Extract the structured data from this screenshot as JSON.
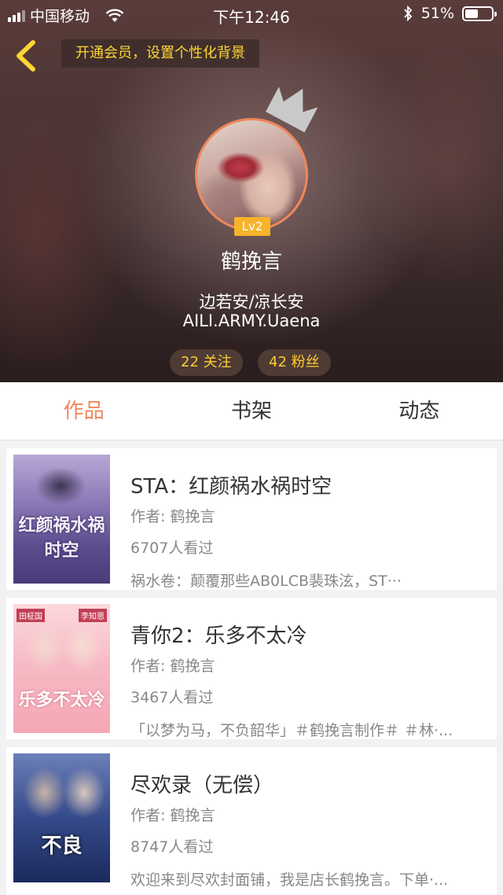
{
  "status_bar": {
    "carrier": "中国移动",
    "time": "下午12:46",
    "battery": "51%",
    "battery_level": 0.51
  },
  "header": {
    "vip_banner": "开通会员，设置个性化背景"
  },
  "profile": {
    "level": "Lv2",
    "username": "鹤挽言",
    "bio_line1": "边若安/凉长安",
    "bio_line2": "AILI.ARMY.Uaena",
    "following": "22 关注",
    "fans": "42 粉丝"
  },
  "tabs": [
    {
      "label": "作品",
      "active": true
    },
    {
      "label": "书架",
      "active": false
    },
    {
      "label": "动态",
      "active": false
    }
  ],
  "works": [
    {
      "title": "STA：红颜祸水祸时空",
      "author": "作者: 鹤挽言",
      "views": "6707人看过",
      "desc": "祸水卷：颠覆那些AB0LCB裴珠泫，ST···",
      "cover_text": "红颜祸水祸时空"
    },
    {
      "title": "青你2：乐多不太冷",
      "author": "作者: 鹤挽言",
      "views": "3467人看过",
      "desc": "「以梦为马，不负韶华」＃鹤挽言制作＃ ＃林·...",
      "cover_text": "乐多不太冷",
      "cover_tag_left": "田柾国",
      "cover_tag_right": "李知恩"
    },
    {
      "title": "尽欢录（无偿）",
      "author": "作者: 鹤挽言",
      "views": "8747人看过",
      "desc": "欢迎来到尽欢封面铺，我是店长鹤挽言。下单·...",
      "cover_text": "不良"
    }
  ]
}
